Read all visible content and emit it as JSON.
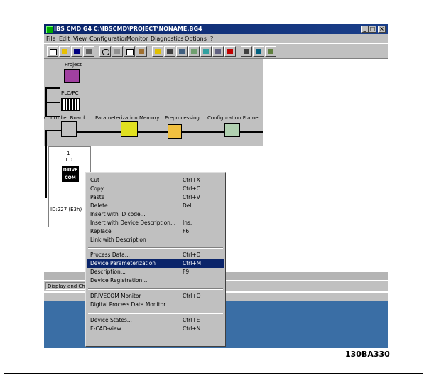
{
  "window": {
    "title": "IBS CMD G4 C:\\IBSCMD\\PROJECT\\NONAME.BG4",
    "controls": {
      "minimize": "_",
      "maximize": "□",
      "close": "×"
    }
  },
  "menubar": [
    "File",
    "Edit",
    "View",
    "Configuration",
    "Monitor",
    "Diagnostics",
    "Options",
    "?"
  ],
  "toolbar": [
    "new",
    "open",
    "save",
    "print",
    "undo",
    "cut",
    "copy",
    "paste",
    "tool-1",
    "tool-2",
    "tool-3",
    "tool-4",
    "tool-5",
    "tool-6",
    "tool-7",
    "tool-8",
    "tool-9",
    "tool-10"
  ],
  "tree": {
    "project": "Project",
    "plc": "PLC/PC",
    "controller": "Controller Board",
    "param_memory": "Parameterization Memory",
    "preprocessing": "Preprocessing",
    "config_frame": "Configuration Frame"
  },
  "device": {
    "number": "1",
    "address": "1.0",
    "logo_top": "DRIVE",
    "logo_bottom": "COM",
    "id": "ID:227 (E3h)"
  },
  "status": {
    "text": "Display and Ch"
  },
  "context_menu": {
    "items": [
      {
        "label": "Cut",
        "shortcut": "Ctrl+X"
      },
      {
        "label": "Copy",
        "shortcut": "Ctrl+C"
      },
      {
        "label": "Paste",
        "shortcut": "Ctrl+V"
      },
      {
        "label": "Delete",
        "shortcut": "Del."
      },
      {
        "label": "Insert with ID code...",
        "shortcut": ""
      },
      {
        "label": "Insert with Device Description...",
        "shortcut": "Ins."
      },
      {
        "label": "Replace",
        "shortcut": "F6"
      },
      {
        "label": "Link with Description",
        "shortcut": ""
      },
      {
        "label": "Process Data...",
        "shortcut": "Ctrl+D"
      },
      {
        "label": "Device Parameterization",
        "shortcut": "Ctrl+M",
        "selected": true
      },
      {
        "label": "Description...",
        "shortcut": "F9"
      },
      {
        "label": "Device Registration...",
        "shortcut": ""
      },
      {
        "label": "DRIVECOM Monitor",
        "shortcut": "Ctrl+O"
      },
      {
        "label": "Digital Process Data Monitor",
        "shortcut": ""
      },
      {
        "label": "Device States...",
        "shortcut": "Ctrl+E"
      },
      {
        "label": "E-CAD-View...",
        "shortcut": "Ctrl+N..."
      }
    ]
  },
  "figure_code": "130BA330"
}
